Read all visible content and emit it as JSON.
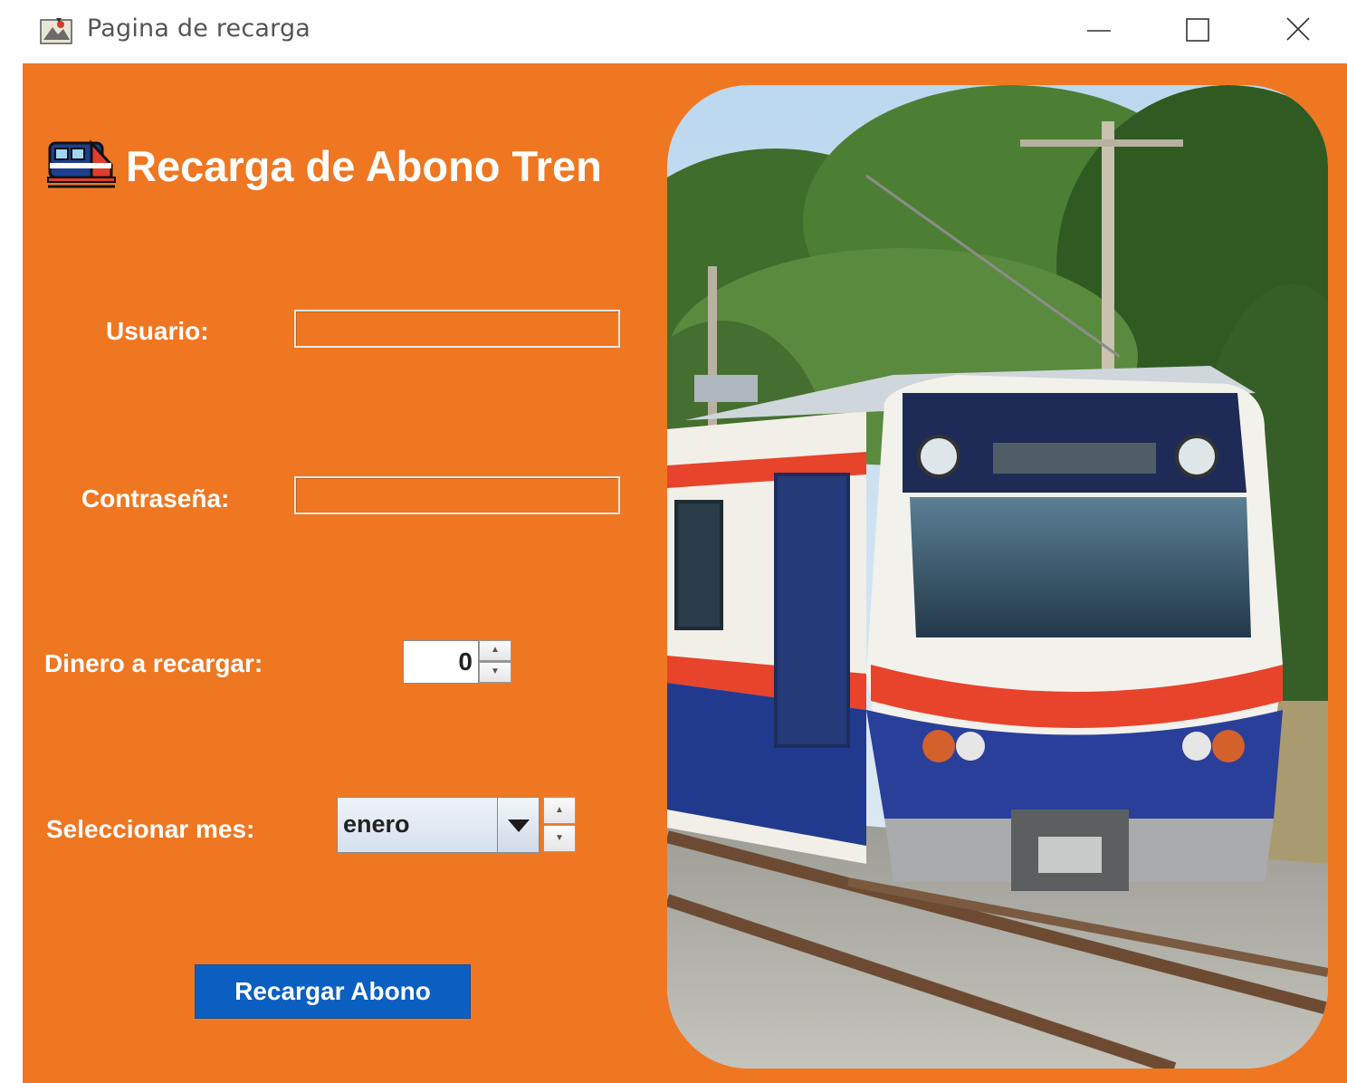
{
  "window": {
    "title": "Pagina de recarga",
    "controls": [
      "minimize",
      "maximize",
      "close"
    ]
  },
  "form": {
    "heading": "Recarga de Abono Tren",
    "heading_icon": "train-icon",
    "usuario_label": "Usuario:",
    "usuario_value": "",
    "password_label": "Contraseña:",
    "password_value": "",
    "money_label": "Dinero a recargar:",
    "money_value": "0",
    "month_label": "Seleccionar mes:",
    "month_value": "enero",
    "submit_label": "Recargar Abono"
  },
  "colors": {
    "panel_background": "#ef7722",
    "button_background": "#0b5fc1",
    "text": "#ffffff"
  },
  "image": {
    "subject": "train-photo"
  }
}
